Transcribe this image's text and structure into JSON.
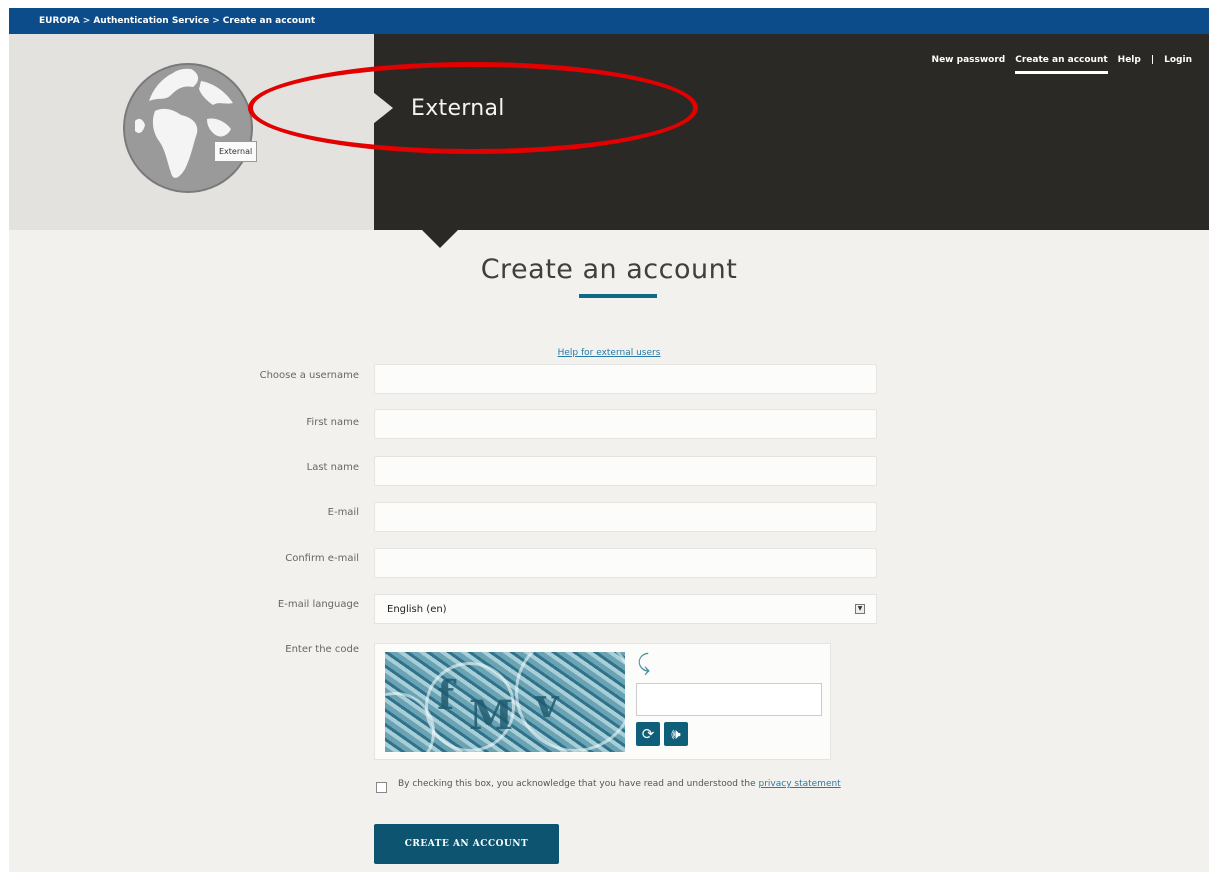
{
  "breadcrumb": [
    "EUROPA",
    "Authentication Service",
    "Create an account"
  ],
  "breadcrumb_separator": ">",
  "header": {
    "title": "External",
    "globe_tag": "External",
    "nav": [
      {
        "label": "New password"
      },
      {
        "label": "Create an account",
        "active": true
      },
      {
        "label": "Help"
      },
      {
        "label": "|"
      },
      {
        "label": "Login"
      }
    ]
  },
  "main": {
    "title": "Create an account",
    "help_link": "Help for external users",
    "fields": {
      "username": {
        "label": "Choose a username",
        "value": ""
      },
      "first_name": {
        "label": "First name",
        "value": ""
      },
      "last_name": {
        "label": "Last name",
        "value": ""
      },
      "email": {
        "label": "E-mail",
        "value": ""
      },
      "confirm_email": {
        "label": "Confirm e-mail",
        "value": ""
      },
      "language": {
        "label": "E-mail language",
        "value": "English (en)"
      }
    },
    "captcha": {
      "label": "Enter the code",
      "value": ""
    },
    "consent": {
      "text": "By checking this box, you acknowledge that you have read and understood the",
      "link": "privacy statement"
    },
    "submit_label": "CREATE AN ACCOUNT"
  },
  "colors": {
    "topbar": "#0d4c8a",
    "header_dark": "#2b2926",
    "accent": "#0d5470",
    "annotation": "#e30000"
  },
  "icons": [
    "globe-icon",
    "refresh-icon",
    "audio-icon",
    "select-arrow-icon"
  ]
}
